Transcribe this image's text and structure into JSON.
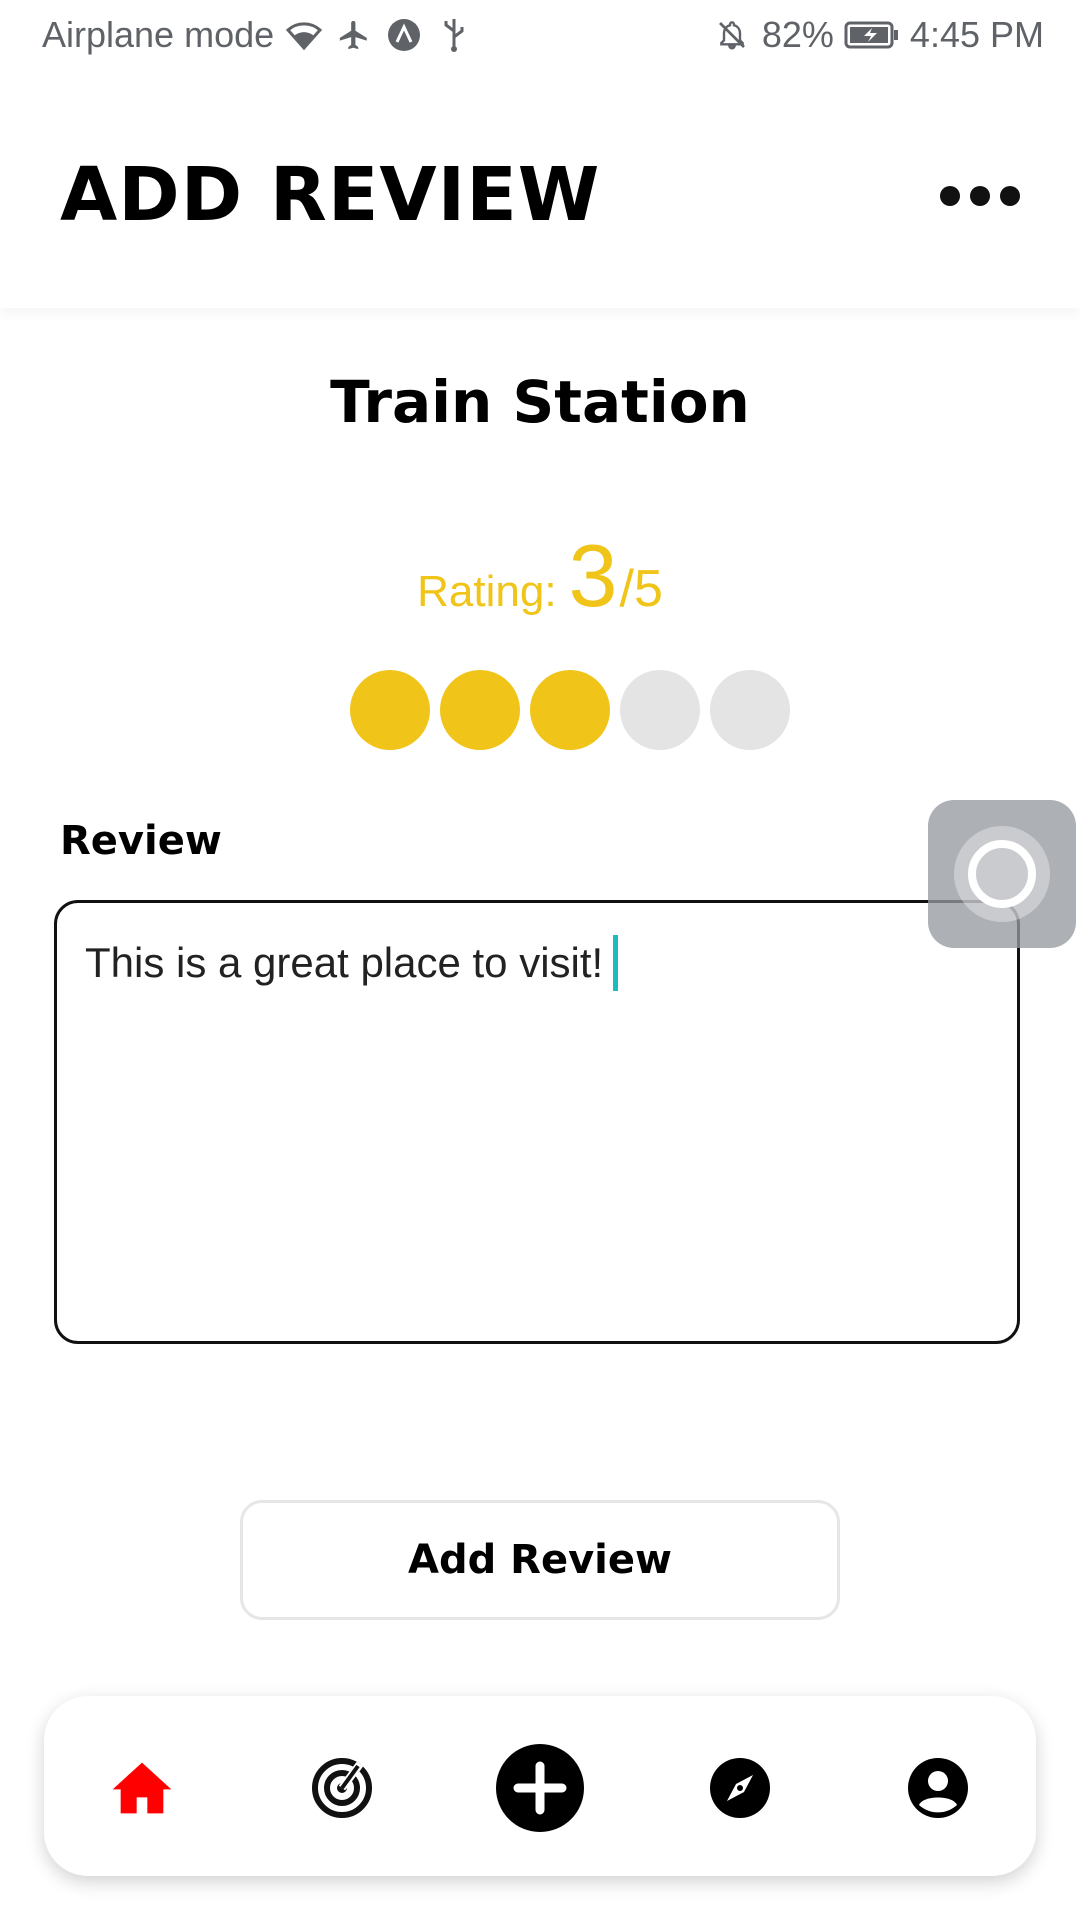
{
  "status_bar": {
    "left_text": "Airplane mode",
    "battery": "82%",
    "time": "4:45 PM",
    "icons": [
      "wifi-icon",
      "airplane-icon",
      "app-notification-icon",
      "usb-icon",
      "notifications-off-icon",
      "battery-charging-icon"
    ]
  },
  "header": {
    "title": "ADD REVIEW",
    "menu_icon": "more-horizontal-icon"
  },
  "place": {
    "name": "Train Station"
  },
  "rating": {
    "label": "Rating:",
    "value": "3",
    "max": "/5",
    "filled_count": 3,
    "total": 5,
    "filled_color": "#f0c419",
    "empty_color": "#e4e4e4"
  },
  "review": {
    "label": "Review",
    "text": "This is a great place to visit!"
  },
  "actions": {
    "add_review_label": "Add Review"
  },
  "bottom_nav": {
    "items": [
      {
        "icon": "home-icon",
        "active": true,
        "color": "#ff0000"
      },
      {
        "icon": "radar-icon",
        "active": false
      },
      {
        "icon": "add-circle-icon",
        "active": false
      },
      {
        "icon": "compass-icon",
        "active": false
      },
      {
        "icon": "account-circle-icon",
        "active": false
      }
    ]
  },
  "colors": {
    "accent_yellow": "#f0c419",
    "caret": "#1bbcbc",
    "active_nav": "#ff0000"
  }
}
